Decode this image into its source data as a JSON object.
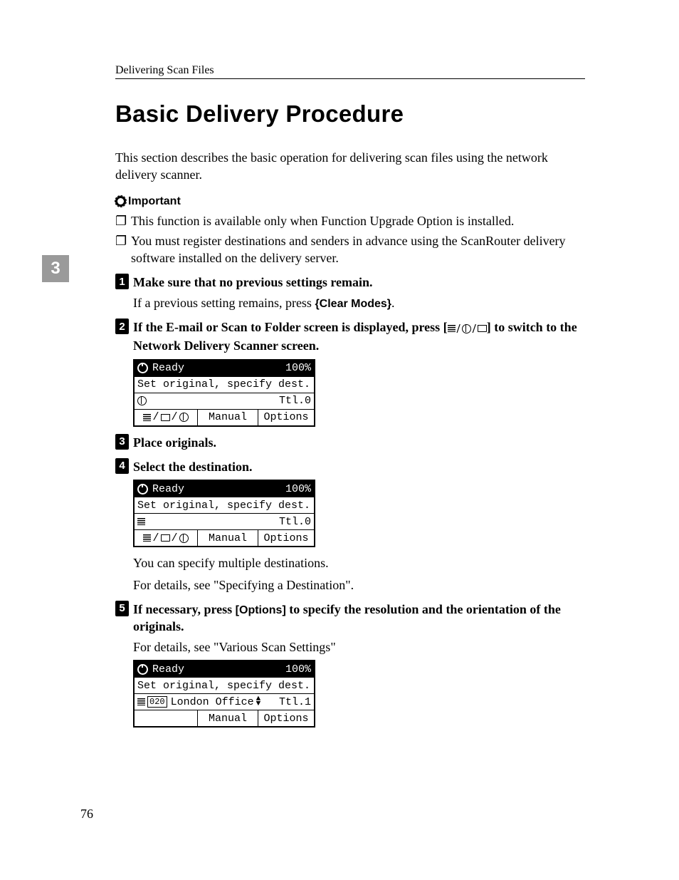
{
  "header": "Delivering Scan Files",
  "title": "Basic Delivery Procedure",
  "chapter": "3",
  "page_number": "76",
  "intro": "This section describes the basic operation for delivering scan files using the network delivery scanner.",
  "important_label": "Important",
  "important_items": [
    "This function is available only when Function Upgrade Option is installed.",
    "You must register destinations and senders in advance using the ScanRouter delivery software installed on the delivery server."
  ],
  "steps": {
    "s1": {
      "text": "Make sure that no previous settings remain.",
      "sub_pre": "If a previous setting remains, press ",
      "key": "{Clear Modes}",
      "sub_post": "."
    },
    "s2": {
      "pre": "If the E-mail or Scan to Folder screen is displayed, press [",
      "post": "] to switch to the Network Delivery Scanner screen."
    },
    "s3": {
      "text": "Place originals."
    },
    "s4": {
      "text": "Select the destination.",
      "sub1": "You can specify multiple destinations.",
      "sub2": "For details, see \"Specifying a Destination\"."
    },
    "s5": {
      "pre": "If necessary, press ",
      "key": "[Options]",
      "post": " to specify the resolution and the orientation of the originals.",
      "sub": "For details, see \"Various Scan Settings\""
    }
  },
  "lcd": {
    "ready": "Ready",
    "percent": "100%",
    "msg": "Set original, specify dest.",
    "ttl0": "Ttl.0",
    "ttl1": "Ttl.1",
    "manual": "Manual",
    "options": "Options",
    "dest_code": "020",
    "dest_name": "London Office"
  }
}
